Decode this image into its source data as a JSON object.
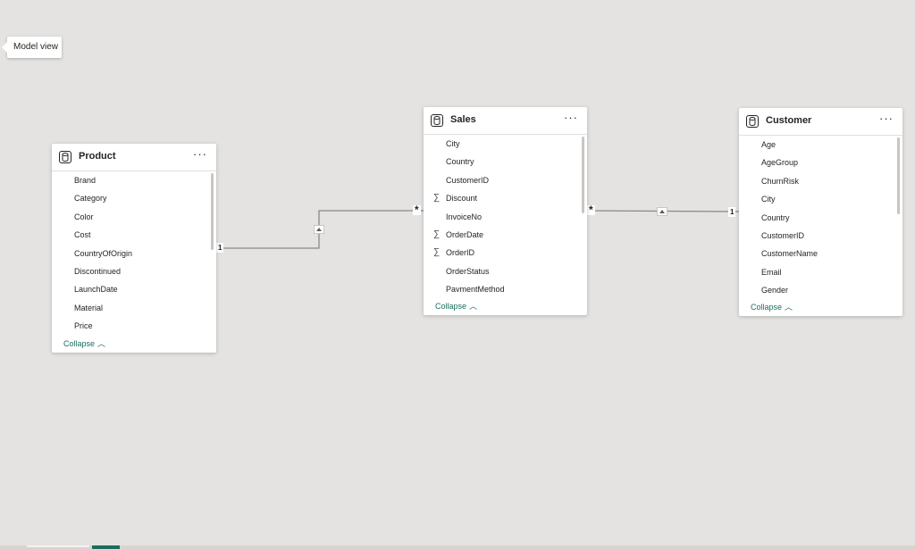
{
  "tooltip": {
    "label": "Model view"
  },
  "tables": {
    "product": {
      "title": "Product",
      "more": "···",
      "fields": [
        {
          "name": "Brand",
          "sum": false
        },
        {
          "name": "Category",
          "sum": false
        },
        {
          "name": "Color",
          "sum": false
        },
        {
          "name": "Cost",
          "sum": false
        },
        {
          "name": "CountryOfOrigin",
          "sum": false
        },
        {
          "name": "Discontinued",
          "sum": false
        },
        {
          "name": "LaunchDate",
          "sum": false
        },
        {
          "name": "Material",
          "sum": false
        },
        {
          "name": "Price",
          "sum": false
        }
      ],
      "collapse": "Collapse"
    },
    "sales": {
      "title": "Sales",
      "more": "···",
      "fields": [
        {
          "name": "City",
          "sum": false
        },
        {
          "name": "Country",
          "sum": false
        },
        {
          "name": "CustomerID",
          "sum": false
        },
        {
          "name": "Discount",
          "sum": true
        },
        {
          "name": "InvoiceNo",
          "sum": false
        },
        {
          "name": "OrderDate",
          "sum": true
        },
        {
          "name": "OrderID",
          "sum": true
        },
        {
          "name": "OrderStatus",
          "sum": false
        },
        {
          "name": "PaymentMethod",
          "sum": false
        }
      ],
      "collapse": "Collapse"
    },
    "customer": {
      "title": "Customer",
      "more": "···",
      "fields": [
        {
          "name": "Age",
          "sum": false
        },
        {
          "name": "AgeGroup",
          "sum": false
        },
        {
          "name": "ChurnRisk",
          "sum": false
        },
        {
          "name": "City",
          "sum": false
        },
        {
          "name": "Country",
          "sum": false
        },
        {
          "name": "CustomerID",
          "sum": false
        },
        {
          "name": "CustomerName",
          "sum": false
        },
        {
          "name": "Email",
          "sum": false
        },
        {
          "name": "Gender",
          "sum": false
        }
      ],
      "collapse": "Collapse"
    }
  },
  "relationships": {
    "product_sales": {
      "from_cardinality": "1",
      "to_cardinality": "*"
    },
    "sales_customer": {
      "from_cardinality": "*",
      "to_cardinality": "1"
    }
  },
  "icons": {
    "table": "table-icon",
    "sum": "sigma-icon",
    "more": "more-options-icon",
    "collapse": "chevron-up-icon",
    "filter_direction": "filter-direction-arrow-icon"
  },
  "colors": {
    "canvas": "#e4e3e1",
    "accent": "#1a6e5d",
    "line": "#8a8886"
  }
}
